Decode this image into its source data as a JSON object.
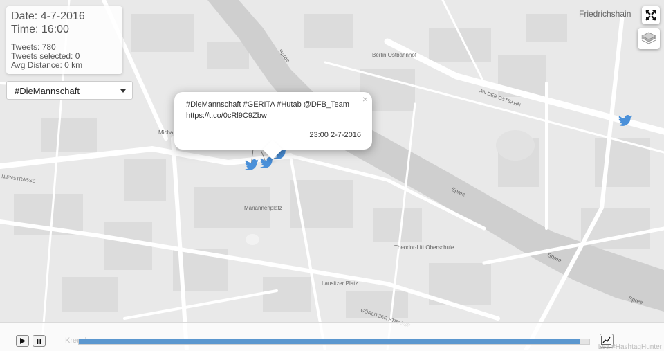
{
  "info": {
    "date": "Date: 4-7-2016",
    "time": "Time: 16:00",
    "tweets": "Tweets: 780",
    "tweets_selected": "Tweets selected: 0",
    "avg_distance": "Avg Distance: 0 km"
  },
  "hashtag_select": {
    "value": "#DieMannschaft"
  },
  "popup": {
    "text_line1": "#DieMannschaft #GERITA #Hutab @DFB_Team",
    "text_line2": "https://t.co/0cRl9C9Zbw",
    "timestamp": "23:00 2-7-2016",
    "close_glyph": "×"
  },
  "map": {
    "labels": {
      "friedrichshain": "Friedrichshain",
      "ostbahnhof": "Berlin Ostbahnhof",
      "spree": "Spree",
      "an_der_ostbahn": "AN DER OSTBAHN",
      "michael": "Micha",
      "niens": "NIENSTRASSE",
      "mariannenplatz": "Mariannenplatz",
      "theodor": "Theodor-Litt Oberschule",
      "lausitzer": "Lausitzer Platz",
      "goerlitzer": "GÖRLITZER STRASSE",
      "kreuzberg": "Kreuzberg"
    },
    "marker_icon": "twitter-bird-icon",
    "marker_color": "#4a90d9"
  },
  "controls": {
    "fullscreen_icon": "fullscreen-icon",
    "layers_icon": "layers-icon",
    "play_icon": "play-icon",
    "pause_icon": "pause-icon",
    "chart_icon": "line-chart-icon"
  },
  "timeline": {
    "progress_fraction": 0.982
  },
  "attribution": {
    "prefix": "Lea",
    "text": "#HashtagHunter"
  },
  "colors": {
    "accent": "#5b97cf",
    "water": "#cfcfcf",
    "twitter": "#4a90d9"
  }
}
